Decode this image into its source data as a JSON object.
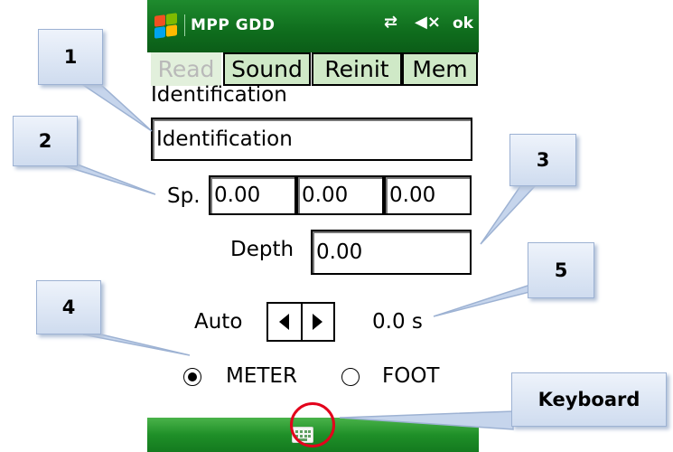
{
  "titlebar": {
    "app_title": "MPP GDD",
    "ok_label": "ok",
    "start_icon": "windows-flag-icon",
    "connectivity_icon": "connection-arrows-icon",
    "volume_icon": "speaker-muted-icon"
  },
  "tabs": [
    {
      "label": "Read",
      "enabled": false
    },
    {
      "label": "Sound",
      "enabled": true
    },
    {
      "label": "Reinit",
      "enabled": true
    },
    {
      "label": "Mem",
      "enabled": true
    }
  ],
  "form": {
    "identification_label": "Identification",
    "identification_value": "Identification",
    "speed_label": "Sp.",
    "speed_values": [
      "0.00",
      "0.00",
      "0.00"
    ],
    "depth_label": "Depth",
    "depth_value": "0.00",
    "auto_label": "Auto",
    "time_value": "0.0 s",
    "units": [
      {
        "label": "METER",
        "selected": true
      },
      {
        "label": "FOOT",
        "selected": false
      }
    ]
  },
  "menubar": {
    "keyboard_icon": "keyboard-icon"
  },
  "callouts": [
    "1",
    "2",
    "3",
    "4",
    "5",
    "Keyboard"
  ],
  "colors": {
    "titlebar_green": "#11741f",
    "tab_fill": "#cfe9c7",
    "callout_fill": "#dbe5f4",
    "highlight_red": "#e3001b"
  }
}
